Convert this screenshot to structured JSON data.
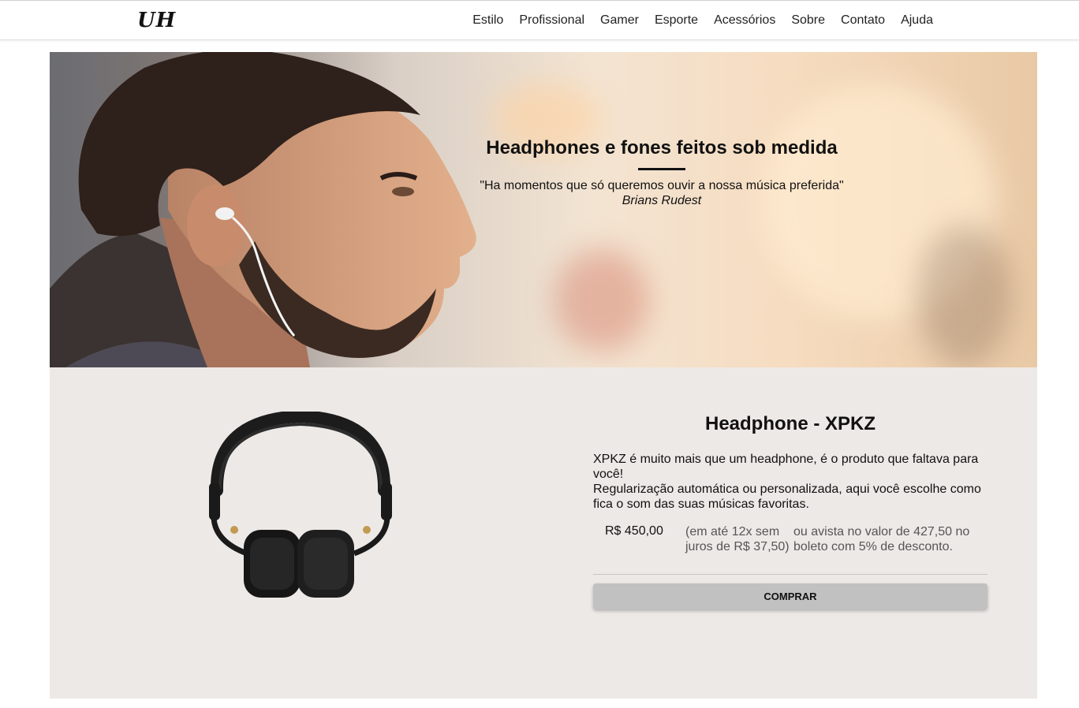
{
  "brand": {
    "logo": "UH"
  },
  "nav": {
    "items": [
      "Estilo",
      "Profissional",
      "Gamer",
      "Esporte",
      "Acessórios",
      "Sobre",
      "Contato",
      "Ajuda"
    ]
  },
  "hero": {
    "title": "Headphones e fones feitos sob medida",
    "quote": "\"Ha momentos que só queremos ouvir a nossa música preferida\"",
    "author": "Brians Rudest"
  },
  "product": {
    "title": "Headphone - XPKZ",
    "description_line1": "XPKZ é muito mais que um headphone, é o produto que faltava para você!",
    "description_line2": "Regularização automática ou personalizada, aqui você escolhe como fica o som das suas músicas favoritas.",
    "price": "R$ 450,00",
    "installments": "(em até 12x sem juros de R$ 37,50)",
    "cash_offer": "ou avista no valor de 427,50 no boleto com 5% de desconto.",
    "buy_label": "COMPRAR"
  },
  "colors": {
    "product_bg": "#ede9e6",
    "button_bg": "#c1c1c1",
    "text": "#111111"
  }
}
